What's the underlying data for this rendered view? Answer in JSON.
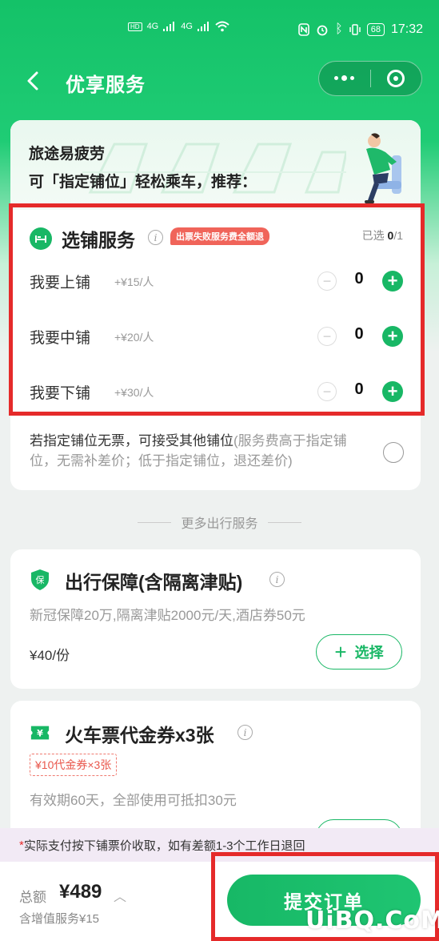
{
  "status_bar": {
    "time": "17:32",
    "battery": "68",
    "signal_icons": [
      "hd-icon",
      "signal-icon",
      "signal-icon",
      "wifi-icon",
      "nfc-icon",
      "alarm-icon",
      "bluetooth-icon",
      "vibrate-icon",
      "battery-icon"
    ],
    "net_label": "4G",
    "hd_label": "HD"
  },
  "nav": {
    "title": "优享服务",
    "back_icon": "chevron-left-icon",
    "more_icon": "more-dots-icon",
    "close_icon": "target-circle-icon"
  },
  "intro": {
    "line1": "旅途易疲劳",
    "line2": "可「指定铺位」轻松乘车，推荐："
  },
  "berth_service": {
    "title": "选铺服务",
    "badge": "出票失败服务费全额退",
    "selected_label": "已选",
    "selected_count": "0",
    "selected_total": "/1",
    "rows": [
      {
        "name": "我要上铺",
        "price": "+¥15/人",
        "count": "0"
      },
      {
        "name": "我要中铺",
        "price": "+¥20/人",
        "count": "0"
      },
      {
        "name": "我要下铺",
        "price": "+¥30/人",
        "count": "0"
      }
    ],
    "minus": "−",
    "plus": "+",
    "accept_main": "若指定铺位无票，可接受其他铺位",
    "accept_note": "(服务费高于指定铺位，无需补差价；低于指定铺位，退还差价)"
  },
  "more_services_label": "更多出行服务",
  "insurance": {
    "icon_text": "保",
    "title": "出行保障(含隔离津贴)",
    "desc": "新冠保障20万,隔离津贴2000元/天,酒店券50元",
    "price": "¥40/份",
    "select_label": "选择",
    "select_plus": "+"
  },
  "coupon": {
    "icon_text": "¥",
    "title": "火车票代金券x3张",
    "tag": "¥10代金券×3张",
    "desc": "有效期60天，全部使用可抵扣30元"
  },
  "notice": {
    "star": "*",
    "text": "实际支付按下铺票价收取，如有差额1-3个工作日退回"
  },
  "bottom": {
    "total_label": "总额",
    "total_price": "¥489",
    "caret": "︿",
    "addon": "含增值服务¥15",
    "submit": "提交订单"
  },
  "watermark": "UiBQ.CoM",
  "colors": {
    "brand_green": "#18b765",
    "highlight_red": "#e52a2a",
    "badge_red": "#f0645a"
  }
}
